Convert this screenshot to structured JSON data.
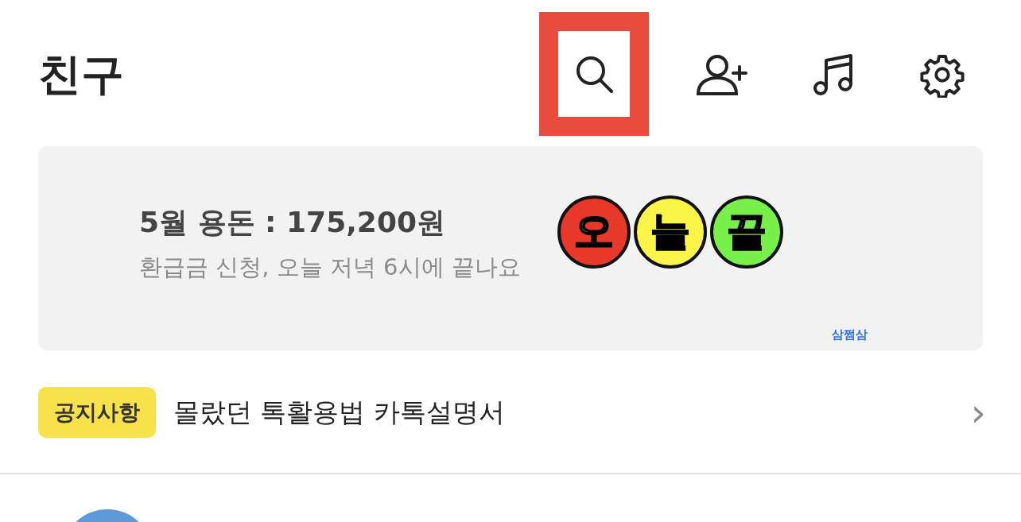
{
  "header": {
    "title": "친구",
    "actions": [
      {
        "kind": "search",
        "highlighted": true
      },
      {
        "kind": "add-friend",
        "highlighted": false
      },
      {
        "kind": "music",
        "highlighted": false
      },
      {
        "kind": "settings",
        "highlighted": false
      }
    ]
  },
  "banner": {
    "title": "5월 용돈 : 175,200원",
    "subtitle": "환급금 신청, 오늘 저녁 6시에 끝나요",
    "badges": [
      {
        "text": "오",
        "color": "#e8382a"
      },
      {
        "text": "늘",
        "color": "#fbf54a"
      },
      {
        "text": "끝",
        "color": "#78f04a"
      }
    ],
    "brand": "삼쩜삼"
  },
  "notice": {
    "tag": "공지사항",
    "text": "몰랐던 톡활용법 카톡설명서",
    "chevron": "›"
  }
}
